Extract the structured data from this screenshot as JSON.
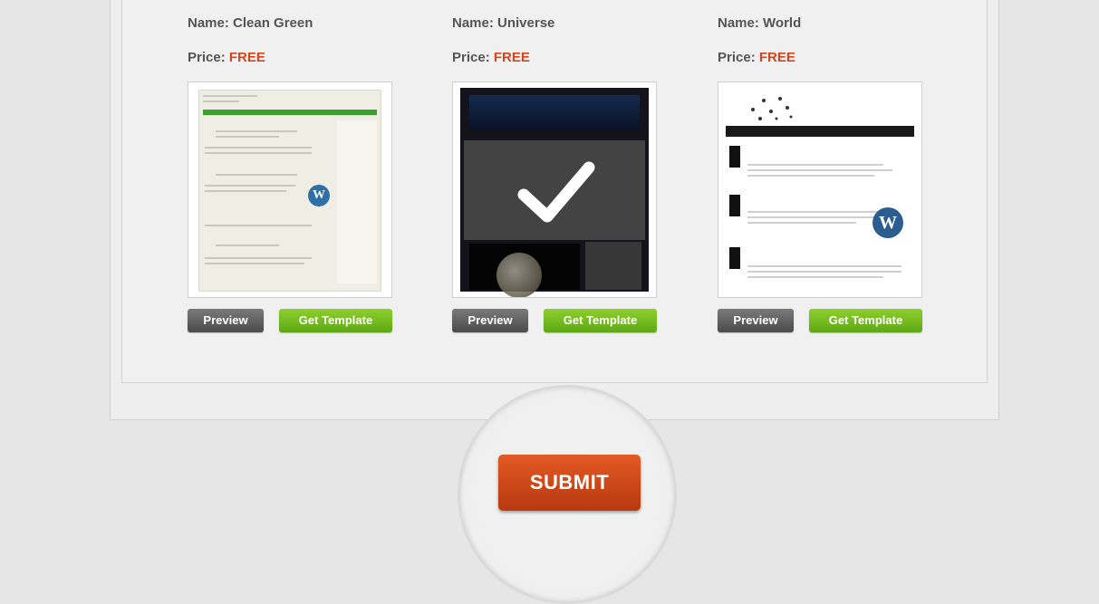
{
  "cards": [
    {
      "name_text": "Name: Clean Green",
      "price_label": "Price:",
      "price_value": "FREE",
      "preview_label": "Preview",
      "get_label": "Get Template",
      "selected": false
    },
    {
      "name_text": "Name: Universe",
      "price_label": "Price:",
      "price_value": "FREE",
      "preview_label": "Preview",
      "get_label": "Get Template",
      "selected": true
    },
    {
      "name_text": "Name: World",
      "price_label": "Price:",
      "price_value": "FREE",
      "preview_label": "Preview",
      "get_label": "Get Template",
      "selected": false
    }
  ],
  "submit": {
    "label": "SUBMIT"
  },
  "colors": {
    "price_free": "#d0461e",
    "get_template_green": "#5ea814",
    "preview_gray": "#4a4a4a",
    "submit_orange": "#c8441a"
  }
}
